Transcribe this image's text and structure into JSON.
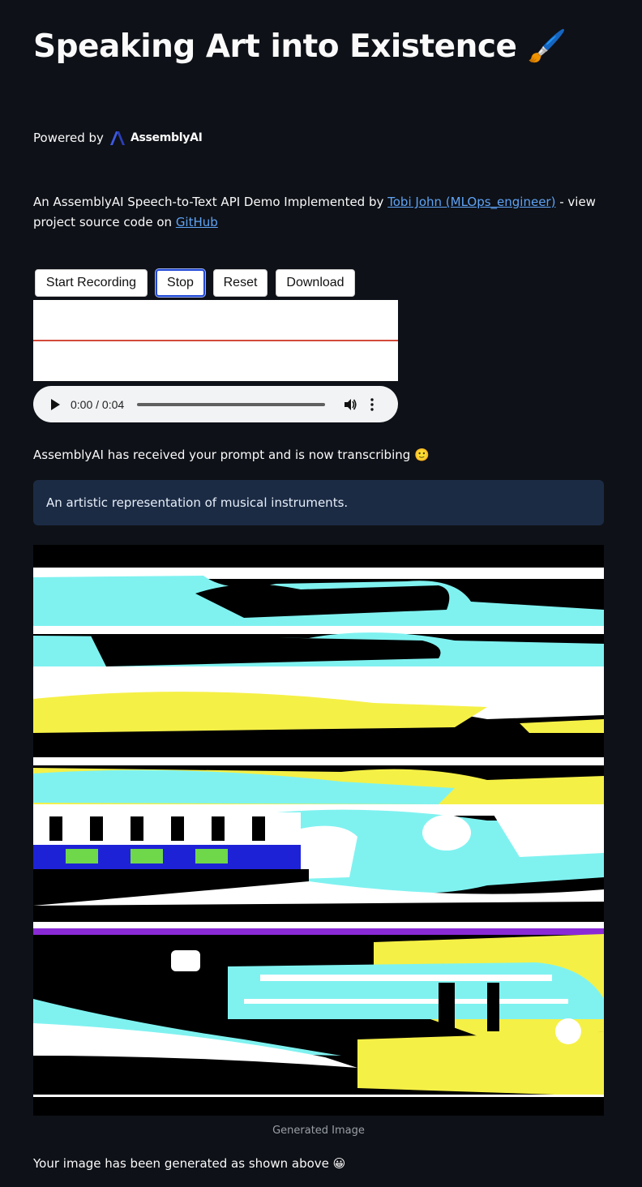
{
  "header": {
    "title": "Speaking Art into Existence",
    "title_emoji": "🖌️"
  },
  "powered": {
    "label": "Powered by",
    "logo_text": "AssemblyAI"
  },
  "description": {
    "text_before": "An AssemblyAI Speech-to-Text API Demo Implemented by ",
    "author_link": "Tobi John (MLOps_engineer)",
    "text_middle": " - view project source code on ",
    "github_link": "GitHub"
  },
  "recorder": {
    "buttons": {
      "start": "Start Recording",
      "stop": "Stop",
      "reset": "Reset",
      "download": "Download"
    },
    "active_button": "stop",
    "waveform_color": "#d34a3a"
  },
  "audio_player": {
    "time": "0:00 / 0:04",
    "progress": 0.0,
    "icons": [
      "play-icon",
      "volume-icon",
      "more-options-icon"
    ]
  },
  "status_message": "AssemblyAI has received your prompt and is now transcribing 🙂",
  "transcript": "An artistic representation of musical instruments.",
  "image": {
    "caption": "Generated Image"
  },
  "final_message": "Your image has been generated as shown above 😀",
  "colors": {
    "background": "#0e1117",
    "link": "#5fa3f5",
    "info_box": "#1c2b44"
  }
}
